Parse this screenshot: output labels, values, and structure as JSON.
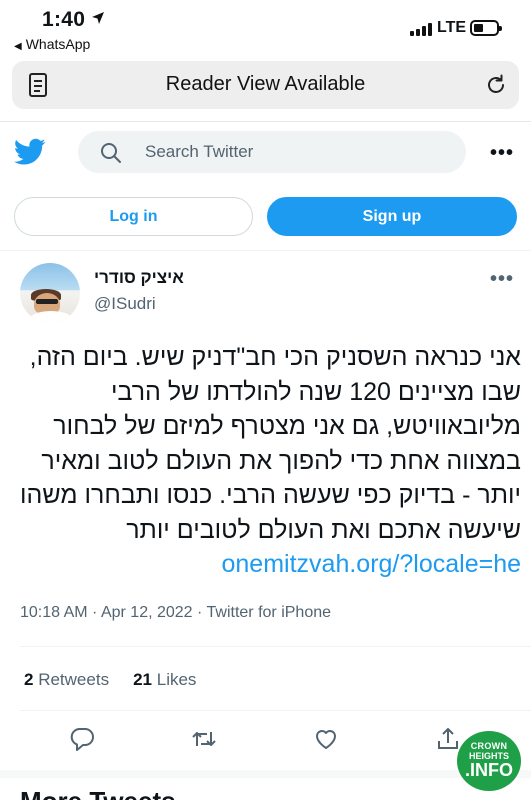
{
  "status_bar": {
    "time": "1:40",
    "back_app": "WhatsApp",
    "network": "LTE"
  },
  "browser": {
    "banner": "Reader View Available"
  },
  "twitter": {
    "search_placeholder": "Search Twitter",
    "login_label": "Log in",
    "signup_label": "Sign up",
    "more_glyph": "•••"
  },
  "tweet": {
    "author_name": "איציק סודרי",
    "author_handle": "@ISudri",
    "body_text": "אני כנראה השסניק הכי חב\"דניק שיש. ביום הזה, שבו מציינים 120 שנה להולדתו של הרבי מליובאוויטש, גם אני מצטרף למיזם של לבחור במצווה אחת כדי להפוך את העולם לטוב ומאיר יותר - בדיוק כפי שעשה הרבי. כנסו ותבחרו משהו שיעשה אתכם ואת העולם לטובים יותר ",
    "link_text": "onemitzvah.org/?locale=he",
    "time": "10:18 AM",
    "date": "Apr 12, 2022",
    "source": "Twitter for iPhone",
    "retweets_count": "2",
    "retweets_label": "Retweets",
    "likes_count": "21",
    "likes_label": "Likes"
  },
  "more_tweets_heading": "More Tweets",
  "watermark": {
    "line1": "CROWN",
    "line2": "HEIGHTS",
    "line3": ".INFO"
  },
  "colors": {
    "twitter_blue": "#1d9bf0",
    "secondary_text": "#536471",
    "watermark_green": "#1fa048"
  },
  "icons": [
    "location-arrow-icon",
    "signal-icon",
    "battery-icon",
    "reader-view-icon",
    "reload-icon",
    "twitter-bird-icon",
    "search-icon",
    "more-icon",
    "reply-icon",
    "retweet-icon",
    "like-icon",
    "share-icon"
  ]
}
